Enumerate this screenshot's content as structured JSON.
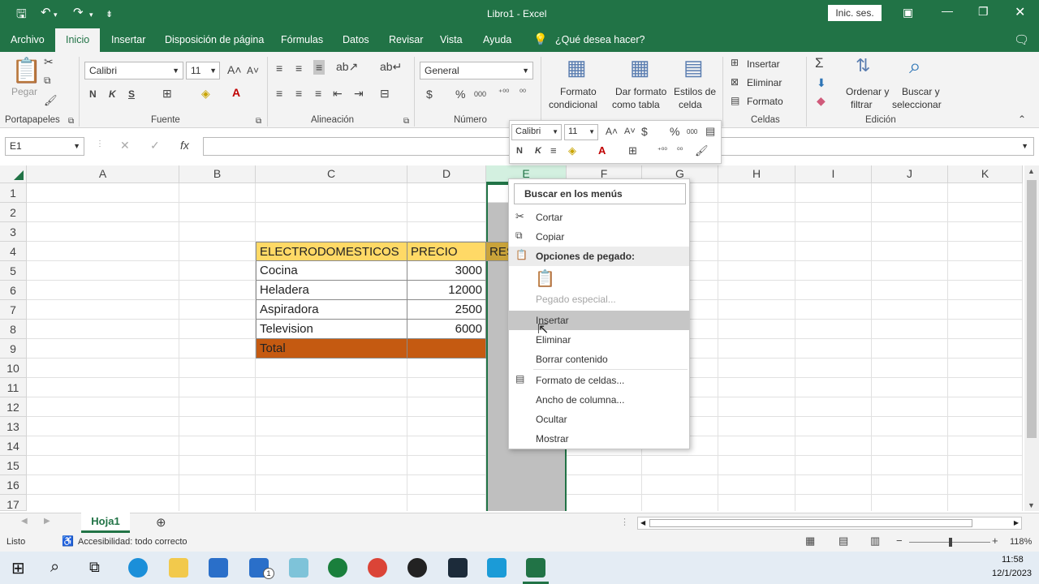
{
  "titlebar": {
    "title": "Libro1  -  Excel",
    "signin": "Inic. ses."
  },
  "menu": [
    "Archivo",
    "Inicio",
    "Insertar",
    "Disposición de página",
    "Fórmulas",
    "Datos",
    "Revisar",
    "Vista",
    "Ayuda",
    "¿Qué desea hacer?"
  ],
  "ribbon": {
    "portapapeles": {
      "label": "Portapapeles",
      "pegar": "Pegar"
    },
    "fuente": {
      "label": "Fuente",
      "font": "Calibri",
      "size": "11",
      "bold": "N",
      "italic": "K",
      "underline": "S"
    },
    "alineacion": {
      "label": "Alineación"
    },
    "numero": {
      "label": "Número",
      "format": "General",
      "currency": "$",
      "percent": "%",
      "thousands": "000"
    },
    "estilos": {
      "label": "Estilos",
      "formato_condicional_1": "Formato",
      "formato_condicional_2": "condicional",
      "dar_formato_1": "Dar formato",
      "dar_formato_2": "como tabla",
      "estilos_celda_1": "Estilos de",
      "estilos_celda_2": "celda"
    },
    "celdas": {
      "label": "Celdas",
      "insertar": "Insertar",
      "eliminar": "Eliminar",
      "formato": "Formato"
    },
    "edicion": {
      "label": "Edición",
      "ordenar_1": "Ordenar y",
      "ordenar_2": "filtrar",
      "buscar_1": "Buscar y",
      "buscar_2": "seleccionar"
    }
  },
  "formulabar": {
    "namebox": "E1",
    "fx": "fx"
  },
  "columns": [
    "A",
    "B",
    "C",
    "D",
    "E",
    "F",
    "G",
    "H",
    "I",
    "J",
    "K"
  ],
  "rows": [
    "1",
    "2",
    "3",
    "4",
    "5",
    "6",
    "7",
    "8",
    "9",
    "10",
    "11",
    "12",
    "13",
    "14",
    "15",
    "16",
    "17"
  ],
  "table": {
    "header": [
      "ELECTRODOMESTICOS",
      "PRECIO",
      "RES"
    ],
    "items": [
      {
        "name": "Cocina",
        "price": "3000"
      },
      {
        "name": "Heladera",
        "price": "12000"
      },
      {
        "name": "Aspiradora",
        "price": "2500"
      },
      {
        "name": "Television",
        "price": "6000"
      }
    ],
    "total": "Total"
  },
  "minitoolbar": {
    "font": "Calibri",
    "size": "11",
    "bold": "N",
    "italic": "K",
    "currency": "$",
    "percent": "%",
    "thousands": "000"
  },
  "contextmenu": {
    "search": "Buscar en los menús",
    "cortar": "Cortar",
    "copiar": "Copiar",
    "opciones_pegado": "Opciones de pegado:",
    "pegado_especial": "Pegado especial...",
    "insertar": "Insertar",
    "eliminar": "Eliminar",
    "borrar": "Borrar contenido",
    "formato_celdas": "Formato de celdas...",
    "ancho": "Ancho de columna...",
    "ocultar": "Ocultar",
    "mostrar": "Mostrar"
  },
  "sheet": {
    "tab": "Hoja1"
  },
  "status": {
    "ready": "Listo",
    "accessibility": "Accesibilidad: todo correcto",
    "zoom": "118%"
  },
  "taskbar": {
    "time": "11:58",
    "date": "12/1/2023",
    "mail_badge": "1"
  },
  "colors": {
    "excel_green": "#217346",
    "header_fill": "#ffd966",
    "total_fill": "#c55a11",
    "selection_gray": "#bfbfbf"
  }
}
